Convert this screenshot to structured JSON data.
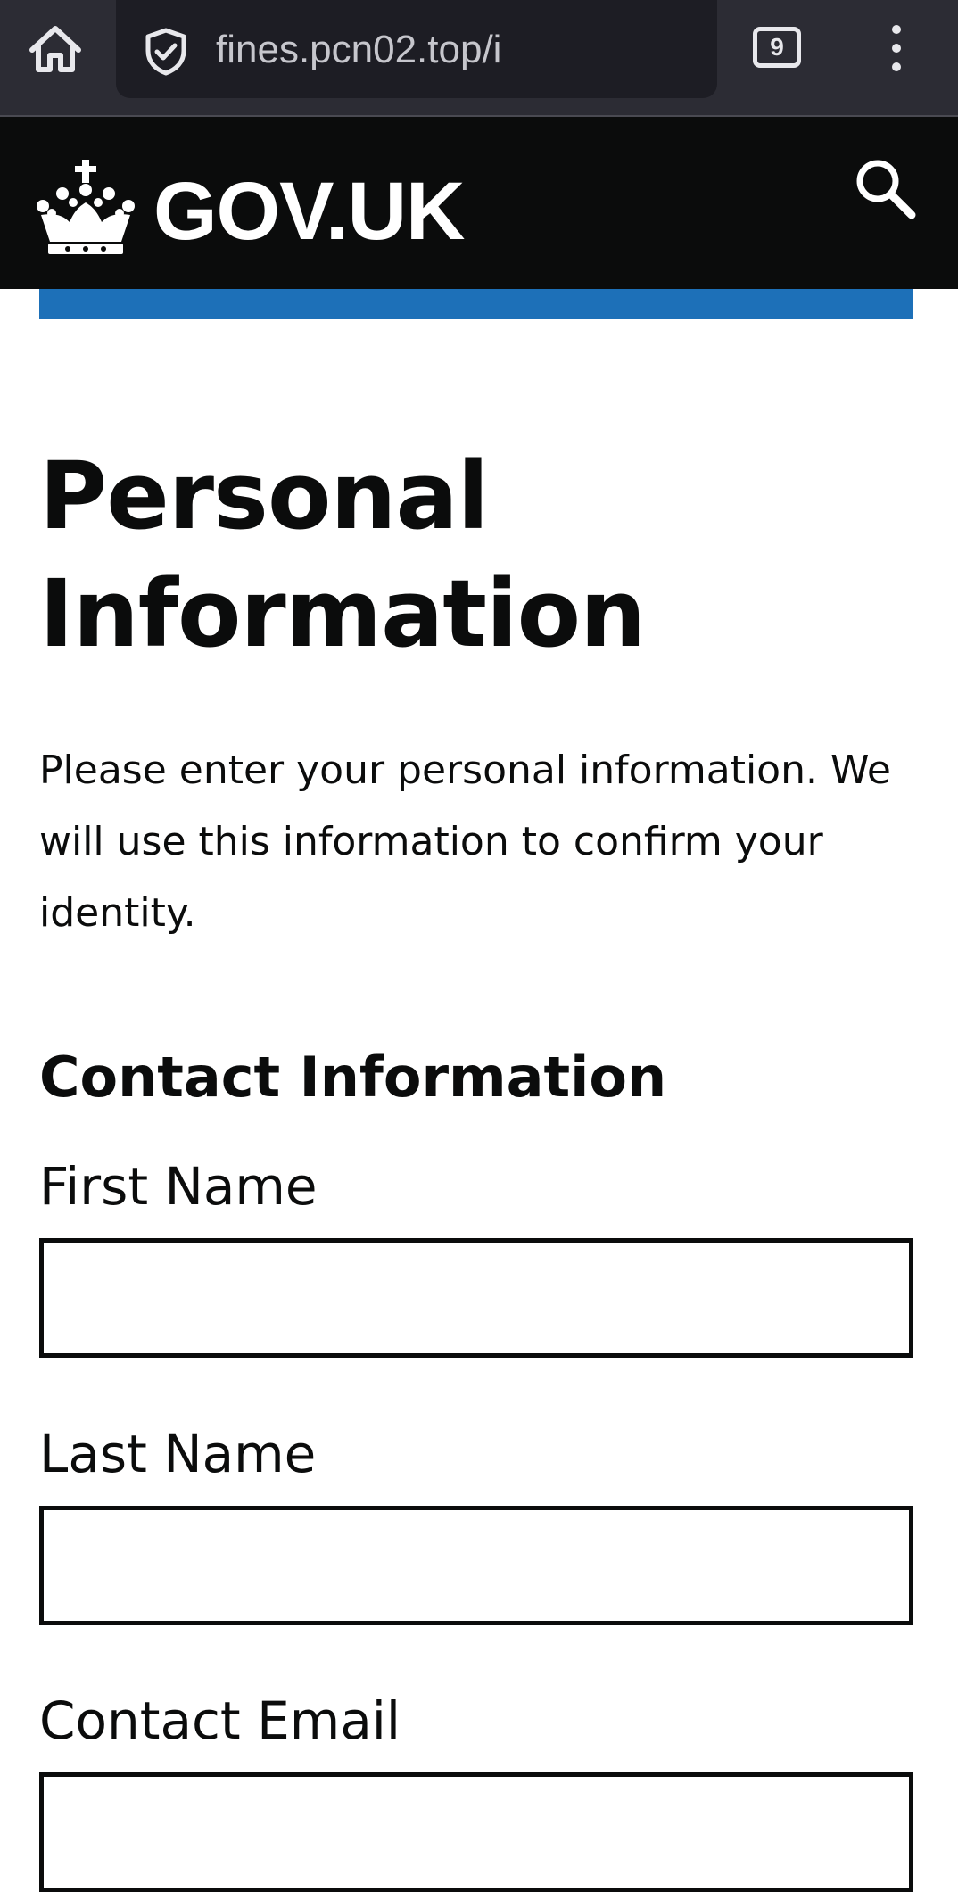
{
  "browser": {
    "url": "fines.pcn02.top/i",
    "tab_count": "9"
  },
  "header": {
    "logotype": "GOV.UK"
  },
  "main": {
    "title": "Personal Information",
    "intro": "Please enter your personal information. We will use this information to confirm your identity.",
    "section_heading": "Contact Information",
    "fields": [
      {
        "label": "First Name",
        "value": "",
        "placeholder": ""
      },
      {
        "label": "Last Name",
        "value": "",
        "placeholder": ""
      },
      {
        "label": "Contact Email",
        "value": "",
        "placeholder": ""
      }
    ]
  },
  "colors": {
    "browser_bar": "#2c2c34",
    "url_box": "#1d1d24",
    "header_background": "#0b0c0c",
    "brand_blue": "#1d70b8",
    "text": "#0b0c0c"
  }
}
